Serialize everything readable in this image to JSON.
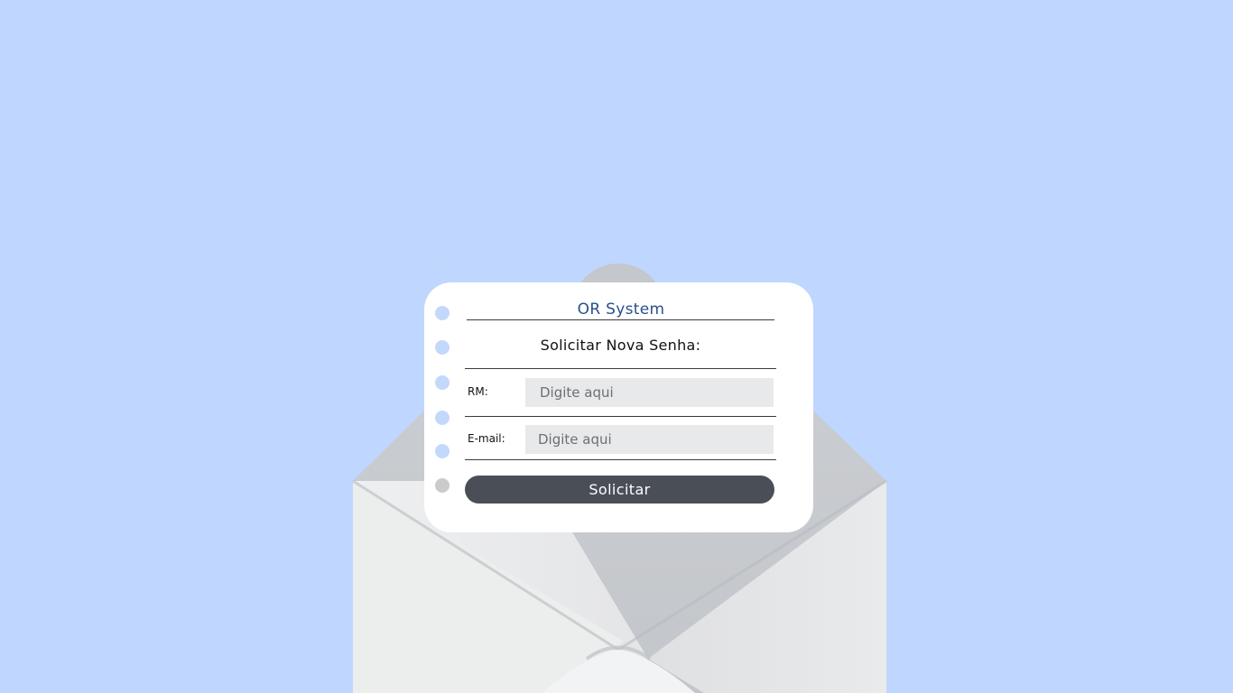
{
  "app": {
    "title": "OR System"
  },
  "form": {
    "heading": "Solicitar Nova Senha:",
    "rm": {
      "label": "RM:",
      "placeholder": "Digite aqui",
      "value": ""
    },
    "email": {
      "label": "E-mail:",
      "placeholder": "Digite aqui",
      "value": ""
    },
    "submit_label": "Solicitar"
  },
  "colors": {
    "background": "#bfd7fe",
    "card": "#ffffff",
    "title": "#2a4f8c",
    "button": "#4a4f57",
    "input": "#e8e9ea",
    "ring_dot": "#c3d9fb",
    "envelope": "#e9eaeb"
  },
  "icons": {
    "envelope": "open-envelope-illustration",
    "binder_holes": "notebook-ring-dots"
  }
}
